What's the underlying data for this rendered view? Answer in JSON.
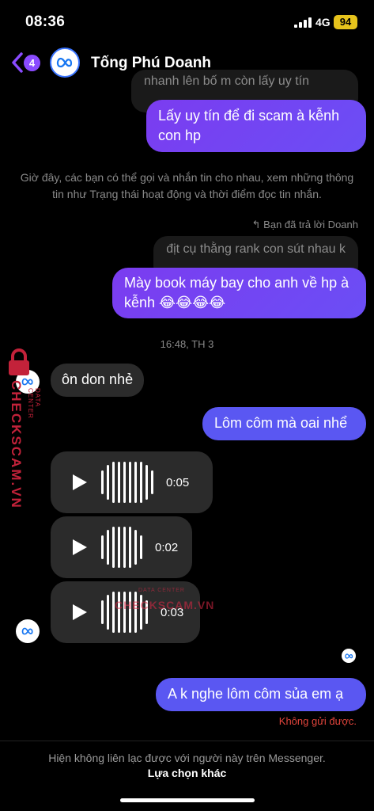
{
  "status": {
    "time": "08:36",
    "network": "4G",
    "battery": "94"
  },
  "header": {
    "back_badge": "4",
    "contact_name": "Tống Phú Doanh"
  },
  "messages": {
    "quote_top": "nhanh lên bố m còn lấy uy tín",
    "sent_1": "Lấy uy tín để đi scam à kễnh con hp",
    "info": "Giờ đây, các bạn có thể gọi và nhắn tin cho nhau, xem những thông tin như Trạng thái hoạt động và thời điểm đọc tin nhắn.",
    "reply_note": "↰ Bạn đã trả lời Doanh",
    "quote_2": "địt cụ thằng rank con sút nhau k",
    "sent_2": "Mày book máy bay cho anh về hp à kễnh 😂😂😂😂",
    "timestamp": "16:48, TH 3",
    "recv_1": "ôn don nhẻ",
    "sent_3": "Lôm côm mà oai nhể",
    "voice": [
      {
        "duration": "0:05"
      },
      {
        "duration": "0:02"
      },
      {
        "duration": "0:03"
      }
    ],
    "sent_4": "A k nghe lôm côm sủa em ạ",
    "error": "Không gửi được."
  },
  "footer": {
    "note": "Hiện không liên lạc được với người này trên Messenger.",
    "link": "Lựa chọn khác"
  },
  "watermark": {
    "side": "CHECKSCAM.VN",
    "side_small": "DATA CENTER",
    "center": "CHECKSCAM.VN",
    "center_small": "DATA CENTER"
  },
  "colors": {
    "sent": "#7b3cf0",
    "sent_blue": "#5a57f2",
    "received": "#2b2b2b",
    "error": "#e0443b",
    "badge": "#8a4bff",
    "battery": "#e6c31c"
  }
}
